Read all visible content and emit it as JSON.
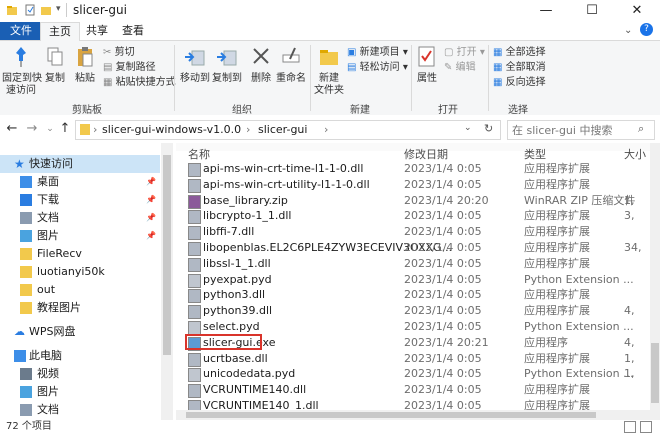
{
  "window": {
    "title": "slicer-gui",
    "controls": {
      "minimize": "—",
      "maximize": "☐",
      "close": "✕"
    }
  },
  "ribbon_tabs": [
    "文件",
    "主页",
    "共享",
    "查看"
  ],
  "ribbon": {
    "clipboard": {
      "pin_label": "固定到快\n速访问",
      "copy_label": "复制",
      "paste_label": "粘贴",
      "cut_label": "剪切",
      "copy_path_label": "复制路径",
      "paste_shortcut_label": "粘贴快捷方式",
      "group_label": "剪贴板"
    },
    "organize": {
      "move_to_label": "移动到",
      "copy_to_label": "复制到",
      "delete_label": "删除",
      "rename_label": "重命名",
      "group_label": "组织"
    },
    "new": {
      "new_folder_label": "新建\n文件夹",
      "new_item_label": "新建项目 ▾",
      "easy_access_label": "轻松访问 ▾",
      "group_label": "新建"
    },
    "open": {
      "properties_label": "属性",
      "open_label": "打开 ▾",
      "edit_label": "编辑",
      "group_label": "打开"
    },
    "select": {
      "select_all_label": "全部选择",
      "select_none_label": "全部取消",
      "invert_label": "反向选择",
      "group_label": "选择"
    }
  },
  "address": {
    "path": [
      "slicer-gui-windows-v1.0.0",
      "slicer-gui"
    ],
    "search_placeholder": "在 slicer-gui 中搜索"
  },
  "nav_pane": {
    "quick_access": "快速访问",
    "items": [
      {
        "label": "桌面",
        "icon": "desktop-icon",
        "pinned": true
      },
      {
        "label": "下载",
        "icon": "download-icon",
        "pinned": true
      },
      {
        "label": "文档",
        "icon": "document-icon",
        "pinned": true
      },
      {
        "label": "图片",
        "icon": "picture-icon",
        "pinned": true
      },
      {
        "label": "FileRecv",
        "icon": "folder-icon",
        "pinned": false
      },
      {
        "label": "luotianyi50k",
        "icon": "folder-icon",
        "pinned": false
      },
      {
        "label": "out",
        "icon": "folder-icon",
        "pinned": false
      },
      {
        "label": "教程图片",
        "icon": "folder-icon",
        "pinned": false
      }
    ],
    "wps": "WPS网盘",
    "this_pc": "此电脑",
    "pc_items": [
      {
        "label": "视频",
        "icon": "video-icon"
      },
      {
        "label": "图片",
        "icon": "picture-icon"
      },
      {
        "label": "文档",
        "icon": "document-icon"
      }
    ]
  },
  "columns": {
    "name": "名称",
    "date": "修改日期",
    "type": "类型",
    "size": "大小"
  },
  "files": [
    {
      "name": "api-ms-win-crt-time-l1-1-0.dll",
      "date": "2023/1/4 0:05",
      "type": "应用程序扩展",
      "size": "",
      "icon": "dll-icon"
    },
    {
      "name": "api-ms-win-crt-utility-l1-1-0.dll",
      "date": "2023/1/4 0:05",
      "type": "应用程序扩展",
      "size": "",
      "icon": "dll-icon"
    },
    {
      "name": "base_library.zip",
      "date": "2023/1/4 20:20",
      "type": "WinRAR ZIP 压缩文件",
      "size": "1,",
      "icon": "zip-icon"
    },
    {
      "name": "libcrypto-1_1.dll",
      "date": "2023/1/4 0:05",
      "type": "应用程序扩展",
      "size": "3,",
      "icon": "dll-icon"
    },
    {
      "name": "libffi-7.dll",
      "date": "2023/1/4 0:05",
      "type": "应用程序扩展",
      "size": "",
      "icon": "dll-icon"
    },
    {
      "name": "libopenblas.EL2C6PLE4ZYW3ECEVIV3OXXG...",
      "date": "2023/1/4 0:05",
      "type": "应用程序扩展",
      "size": "34,",
      "icon": "dll-icon"
    },
    {
      "name": "libssl-1_1.dll",
      "date": "2023/1/4 0:05",
      "type": "应用程序扩展",
      "size": "",
      "icon": "dll-icon"
    },
    {
      "name": "pyexpat.pyd",
      "date": "2023/1/4 0:05",
      "type": "Python Extension ...",
      "size": "",
      "icon": "pyd-icon"
    },
    {
      "name": "python3.dll",
      "date": "2023/1/4 0:05",
      "type": "应用程序扩展",
      "size": "",
      "icon": "dll-icon"
    },
    {
      "name": "python39.dll",
      "date": "2023/1/4 0:05",
      "type": "应用程序扩展",
      "size": "4,",
      "icon": "dll-icon"
    },
    {
      "name": "select.pyd",
      "date": "2023/1/4 0:05",
      "type": "Python Extension ...",
      "size": "",
      "icon": "pyd-icon"
    },
    {
      "name": "slicer-gui.exe",
      "date": "2023/1/4 20:21",
      "type": "应用程序",
      "size": "4,",
      "icon": "exe-icon",
      "highlighted": true
    },
    {
      "name": "ucrtbase.dll",
      "date": "2023/1/4 0:05",
      "type": "应用程序扩展",
      "size": "1,",
      "icon": "dll-icon"
    },
    {
      "name": "unicodedata.pyd",
      "date": "2023/1/4 0:05",
      "type": "Python Extension ...",
      "size": "1,",
      "icon": "pyd-icon"
    },
    {
      "name": "VCRUNTIME140.dll",
      "date": "2023/1/4 0:05",
      "type": "应用程序扩展",
      "size": "",
      "icon": "dll-icon"
    },
    {
      "name": "VCRUNTIME140_1.dll",
      "date": "2023/1/4 0:05",
      "type": "应用程序扩展",
      "size": "",
      "icon": "dll-icon"
    }
  ],
  "status": {
    "count": "72 个项目"
  },
  "colors": {
    "accent": "#1a5fb4",
    "highlight_border": "#d9342b",
    "folder": "#f2c94c"
  }
}
